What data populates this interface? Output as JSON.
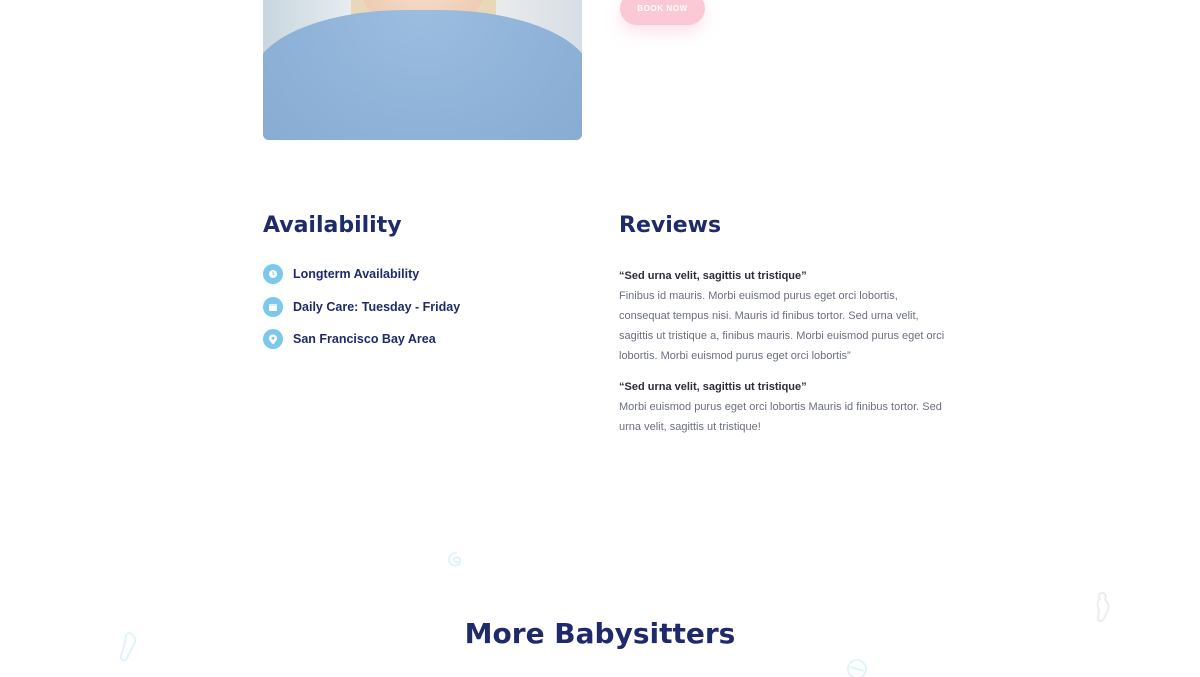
{
  "profile": {
    "book_label": "BOOK NOW"
  },
  "availability": {
    "title": "Availability",
    "items": [
      {
        "label": "Longterm Availability",
        "icon": "clock-icon"
      },
      {
        "label": "Daily Care: Tuesday - Friday",
        "icon": "calendar-icon"
      },
      {
        "label": "San Francisco Bay Area",
        "icon": "location-pin-icon"
      }
    ]
  },
  "reviews": {
    "title": "Reviews",
    "items": [
      {
        "quote": "“Sed urna velit, sagittis ut tristique”",
        "body": "Finibus id mauris. Morbi euismod purus eget orci lobortis, consequat tempus nisi. Mauris id finibus tortor. Sed urna velit, sagittis ut tristique a, finibus mauris. Morbi euismod purus eget orci lobortis. Morbi euismod purus eget orci lobortis”"
      },
      {
        "quote": "“Sed urna velit, sagittis ut tristique”",
        "body": "Morbi euismod purus eget orci lobortis Mauris id finibus tortor. Sed urna velit, sagittis ut tristique!"
      }
    ]
  },
  "more": {
    "title": "More Babysitters"
  },
  "colors": {
    "accent_navy": "#1f2a6b",
    "icon_blue": "#7cc8ec",
    "button_pink": "#fbc9d6"
  }
}
